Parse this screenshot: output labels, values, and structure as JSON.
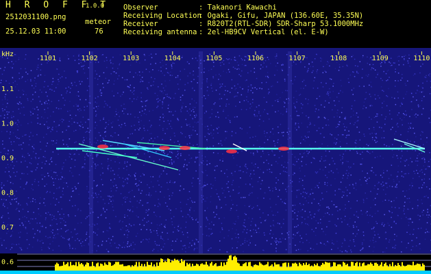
{
  "app": {
    "title": "H R O F F T",
    "version": "1.0.0"
  },
  "record": {
    "filename": "2512031100.png",
    "datetime": "25.12.03 11:00",
    "type": "meteor",
    "count": "76"
  },
  "info": [
    {
      "label": "Observer",
      "value": ": Takanori Kawachi"
    },
    {
      "label": "Receiving Location",
      "value": ": Ogaki, Gifu, JAPAN (136.60E, 35.35N)"
    },
    {
      "label": "Receiver",
      "value": ": R820T2(RTL-SDR) SDR-Sharp 53.1000MHz"
    },
    {
      "label": "Receiving antenna",
      "value": ": 2el-HB9CV Vertical (el. E-W)"
    }
  ],
  "axes": {
    "y_unit": "kHz",
    "x_ticks": [
      "1101",
      "1102",
      "1103",
      "1104",
      "1105",
      "1106",
      "1107",
      "1108",
      "1109",
      "1110"
    ],
    "y_ticks": [
      "1.1",
      "1.0",
      "0.9",
      "0.8",
      "0.7",
      "0.6"
    ]
  },
  "colors": {
    "background": "#000000",
    "noise_base": "#16167a",
    "axis_text": "#ffff55",
    "carrier": "#55ffee",
    "meteor": "#ff3344",
    "level_bar": "#ffee00",
    "level_base": "#00ccff",
    "overlay_line": "#aaaaff"
  }
}
